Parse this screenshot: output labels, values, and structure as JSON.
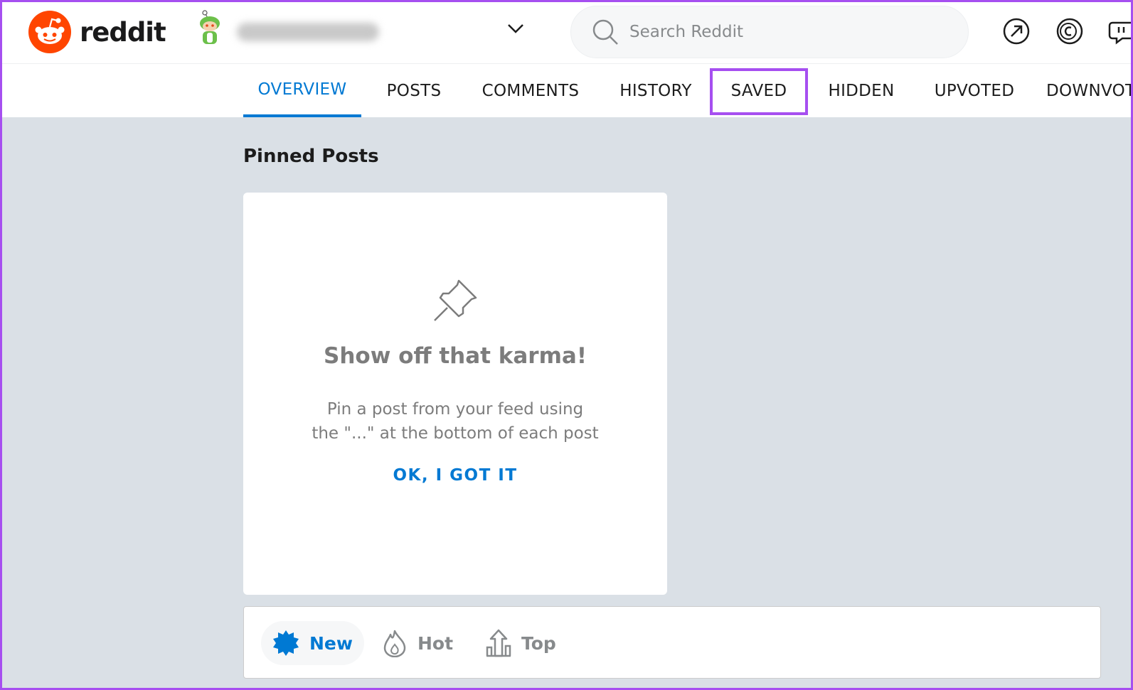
{
  "header": {
    "brand": "reddit",
    "search_placeholder": "Search Reddit",
    "icons": [
      "popular-icon",
      "coins-icon",
      "chat-icon"
    ]
  },
  "tabs": [
    {
      "label": "OVERVIEW",
      "active": true
    },
    {
      "label": "POSTS"
    },
    {
      "label": "COMMENTS"
    },
    {
      "label": "HISTORY"
    },
    {
      "label": "SAVED",
      "highlighted": true
    },
    {
      "label": "HIDDEN"
    },
    {
      "label": "UPVOTED"
    },
    {
      "label": "DOWNVOT"
    }
  ],
  "pinned": {
    "section_title": "Pinned Posts",
    "title": "Show off that karma!",
    "desc_line1": "Pin a post from your feed using",
    "desc_line2": "the \"...\" at the bottom of each post",
    "button": "OK, I GOT IT"
  },
  "sort": [
    {
      "label": "New",
      "icon": "new-burst-icon",
      "active": true
    },
    {
      "label": "Hot",
      "icon": "flame-icon"
    },
    {
      "label": "Top",
      "icon": "top-chart-icon"
    }
  ],
  "colors": {
    "brand_orange": "#ff4500",
    "accent_blue": "#0079d3",
    "highlight_purple": "#a64ff0",
    "page_bg": "#dae0e6"
  }
}
